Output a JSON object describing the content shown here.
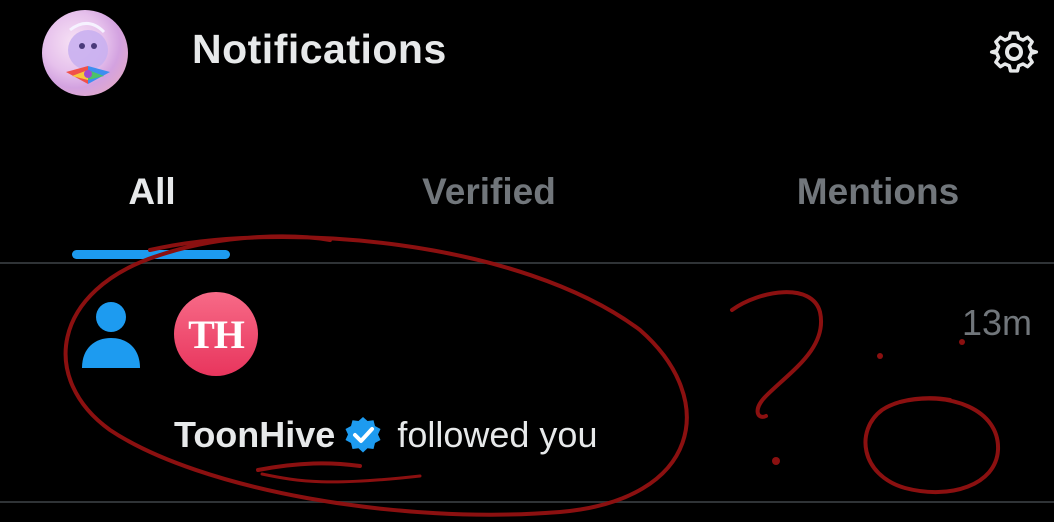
{
  "header": {
    "title": "Notifications",
    "avatar_icon": "profile-avatar",
    "settings_icon": "gear-icon"
  },
  "tabs": [
    {
      "label": "All",
      "active": true
    },
    {
      "label": "Verified",
      "active": false
    },
    {
      "label": "Mentions",
      "active": false
    }
  ],
  "notification": {
    "type_icon": "person-icon",
    "avatar_initials": "TH",
    "user": "ToonHive",
    "verified_icon": "verified-badge-icon",
    "action": "followed you",
    "time": "13m"
  },
  "colors": {
    "background": "#000000",
    "accent": "#1d9bf0",
    "text_primary": "#e7e9ea",
    "text_secondary": "#71767b",
    "annotation": "#8b1010"
  }
}
